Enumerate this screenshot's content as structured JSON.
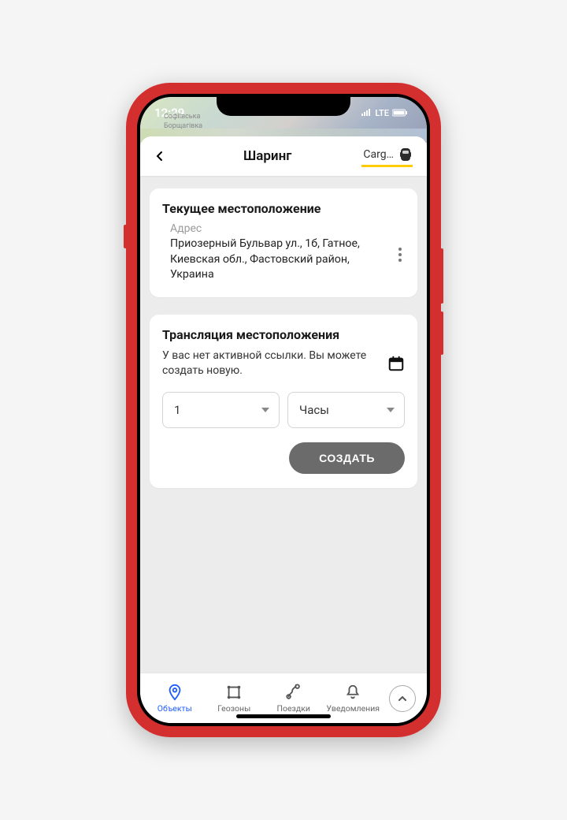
{
  "status": {
    "time": "12:29",
    "net": "LTE",
    "map_hint_top": "Софіївська",
    "map_hint_bottom": "Борщагівка"
  },
  "header": {
    "title": "Шаринг",
    "unit": "Carg…"
  },
  "location_card": {
    "title": "Текущее местоположение",
    "address_label": "Адрес",
    "address": "Приозерный Бульвар ул., 1б, Гатное, Киевская обл., Фастовский район, Украина"
  },
  "broadcast_card": {
    "title": "Трансляция местоположения",
    "info": "У вас нет активной ссылки. Вы можете создать новую.",
    "duration_value": "1",
    "duration_unit": "Часы",
    "create_label": "СОЗДАТЬ"
  },
  "nav": {
    "items": [
      {
        "label": "Объекты"
      },
      {
        "label": "Геозоны"
      },
      {
        "label": "Поездки"
      },
      {
        "label": "Уведомления"
      }
    ]
  }
}
